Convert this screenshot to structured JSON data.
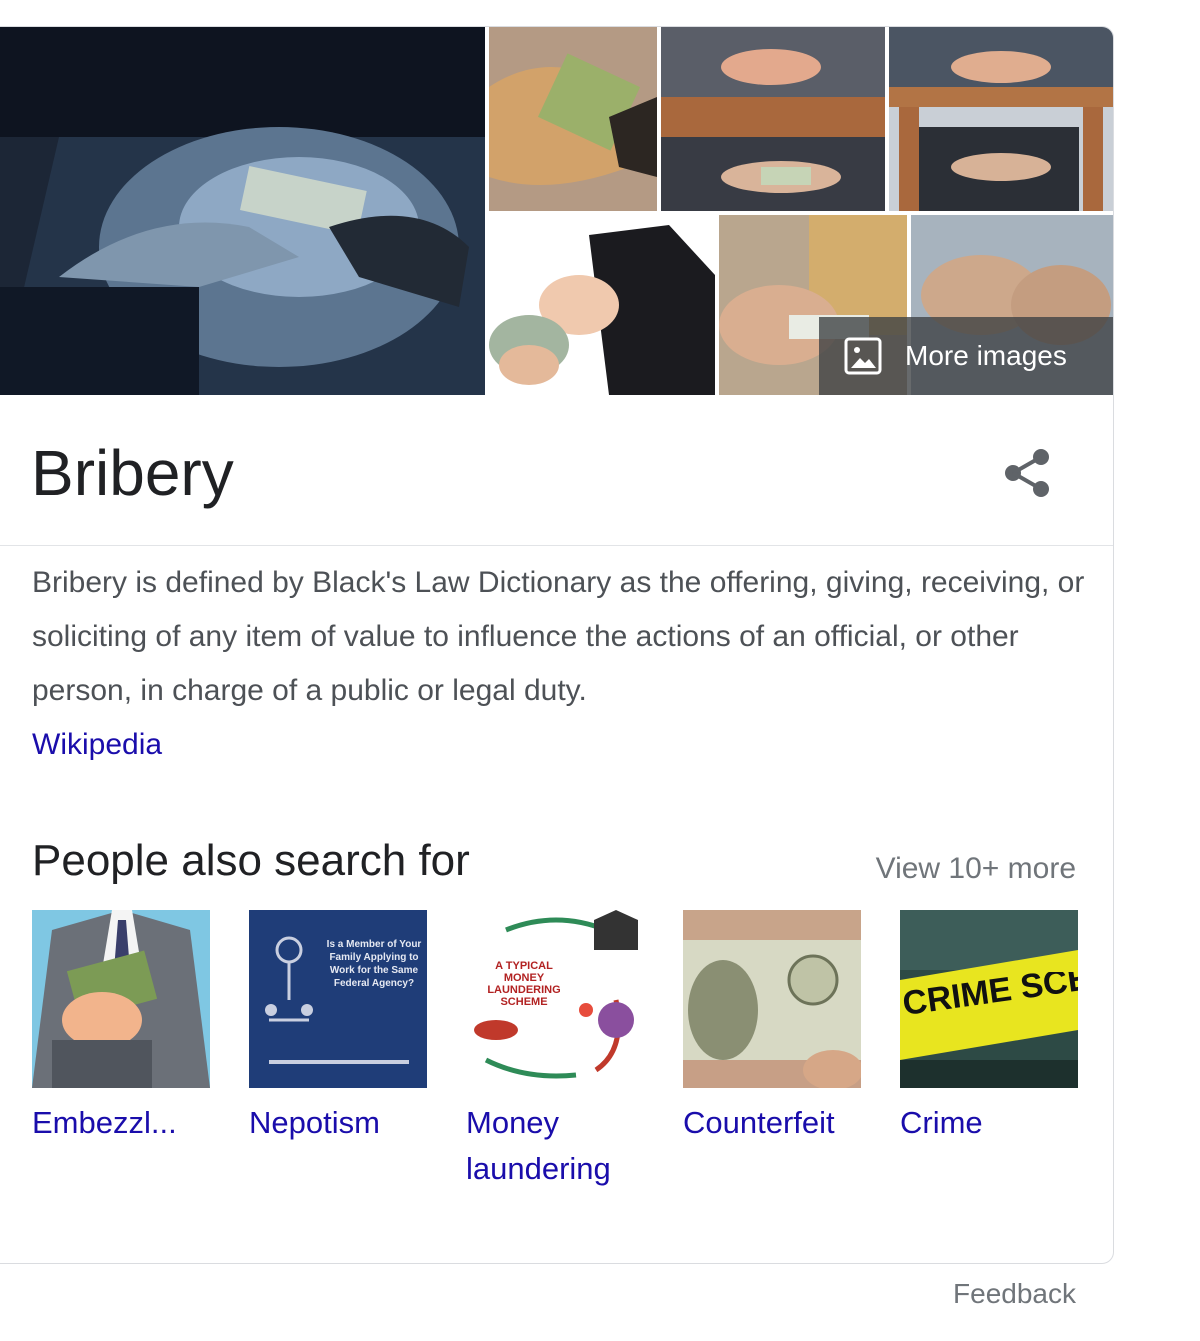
{
  "images": {
    "more_images_label": "More images"
  },
  "entity": {
    "title": "Bribery"
  },
  "description": {
    "text": "Bribery is defined by Black's Law Dictionary as the offering, giving, receiving, or soliciting of any item of value to influence the actions of an official, or other person, in charge of a public or legal duty.",
    "source": "Wikipedia"
  },
  "pasf": {
    "title": "People also search for",
    "view_more": "View 10+ more",
    "items": [
      {
        "label": "Embezzl..."
      },
      {
        "label": "Nepotism"
      },
      {
        "label": "Money laundering"
      },
      {
        "label": "Counterfeit"
      },
      {
        "label": "Crime"
      }
    ],
    "thumb_texts": {
      "nepotism": "Is a Member of Your Family Applying to Work for the Same Federal Agency?",
      "money": "A TYPICAL MONEY LAUNDERING SCHEME",
      "crime": "CRIME SCENE"
    }
  },
  "footer": {
    "feedback": "Feedback"
  },
  "colors": {
    "link": "#1a0dab",
    "text": "#4d5156",
    "heading": "#202124",
    "muted": "#70757a"
  }
}
